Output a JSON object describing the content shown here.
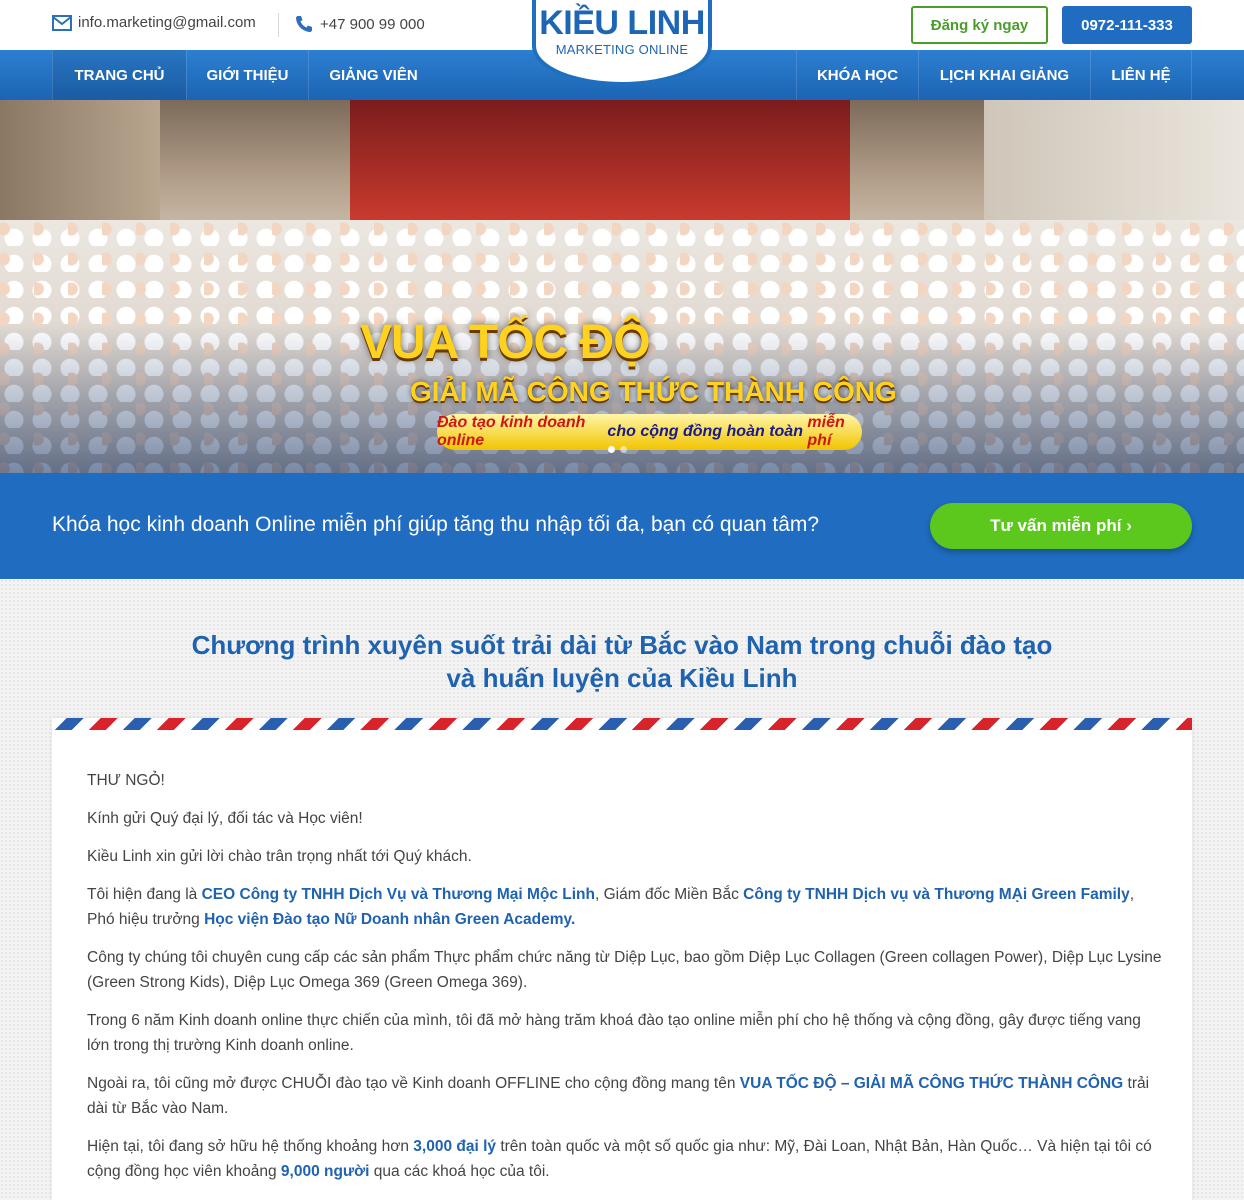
{
  "header": {
    "email": "info.marketing@gmail.com",
    "phone": "+47 900 99 000",
    "logo_title": "KIỀU LINH",
    "logo_subtitle": "MARKETING ONLINE",
    "register_label": "Đăng ký ngay",
    "hotline": "0972-111-333"
  },
  "nav": {
    "items": [
      "TRANG CHỦ",
      "GIỚI THIỆU",
      "GIẢNG VIÊN",
      "KHÓA HỌC",
      "LỊCH KHAI GIẢNG",
      "LIÊN HỆ"
    ],
    "active": "TRANG CHỦ"
  },
  "hero": {
    "title": "VUA TỐC ĐỘ",
    "subtitle": "GIẢI MÃ CÔNG THỨC THÀNH CÔNG",
    "pill_part1": "Đào tạo kinh doanh online",
    "pill_part2": " cho cộng đồng hoàn toàn ",
    "pill_part3": "miễn phí",
    "slide_count": 2,
    "active_slide": 1
  },
  "cta": {
    "text": "Khóa học kinh doanh Online miễn phí giúp tăng thu nhập tối đa, bạn có quan tâm?",
    "button": "Tư vấn miễn phí ›"
  },
  "section": {
    "title_line1": "Chương trình xuyên suốt trải dài từ Bắc vào Nam trong chuỗi đào tạo",
    "title_line2": "và huấn luyện của Kiều Linh"
  },
  "letter": {
    "heading": "THƯ NGỎ!",
    "greeting": "Kính gửi Quý đại lý, đối tác và Học viên!",
    "p1": "Kiều Linh xin gửi lời chào trân trọng nhất tới Quý khách.",
    "p2_a": "Tôi hiện đang là ",
    "p2_b": "CEO Công ty TNHH Dịch Vụ và Thương Mại Mộc Linh",
    "p2_c": ", Giám đốc Miền Bắc ",
    "p2_d": "Công ty TNHH Dịch vụ và Thương MẠi Green Family",
    "p2_e": ", Phó hiệu trưởng ",
    "p2_f": "Học viện Đào tạo Nữ Doanh nhân Green Academy.",
    "p3": "Công ty chúng tôi chuyên cung cấp các sản phẩm Thực phẩm chức năng từ Diệp Lục, bao gồm Diệp Lục Collagen (Green collagen Power), Diệp Lục Lysine (Green Strong Kids), Diệp Lục Omega 369 (Green Omega 369).",
    "p4": "Trong 6 năm Kinh doanh online thực chiến của mình, tôi đã mở hàng trăm khoá đào tạo online miễn phí cho hệ thống và cộng đồng, gây được tiếng vang lớn trong thị trường Kinh doanh online.",
    "p5_a": "Ngoài ra, tôi cũng mở được CHUỖI đào tạo về Kinh doanh OFFLINE cho cộng đồng mang tên ",
    "p5_b": "VUA TỐC ĐỘ – GIẢI MÃ CÔNG THỨC THÀNH CÔNG",
    "p5_c": " trải dài từ Bắc vào Nam.",
    "p6_a": "Hiện tại, tôi đang sở hữu hệ thống khoảng hơn ",
    "p6_b": "3,000 đại lý",
    "p6_c": " trên toàn quốc và một số quốc gia như: Mỹ, Đài Loan, Nhật Bản, Hàn Quốc… Và hiện tại tôi có cộng đồng học viên khoảng ",
    "p6_d": "9,000 người",
    "p6_e": " qua các khoá học của tôi."
  },
  "colors": {
    "brand_blue": "#1f6cc0",
    "cta_green": "#5cc81d",
    "register_green": "#4a9d2b",
    "hero_gold": "#ffd21f"
  }
}
